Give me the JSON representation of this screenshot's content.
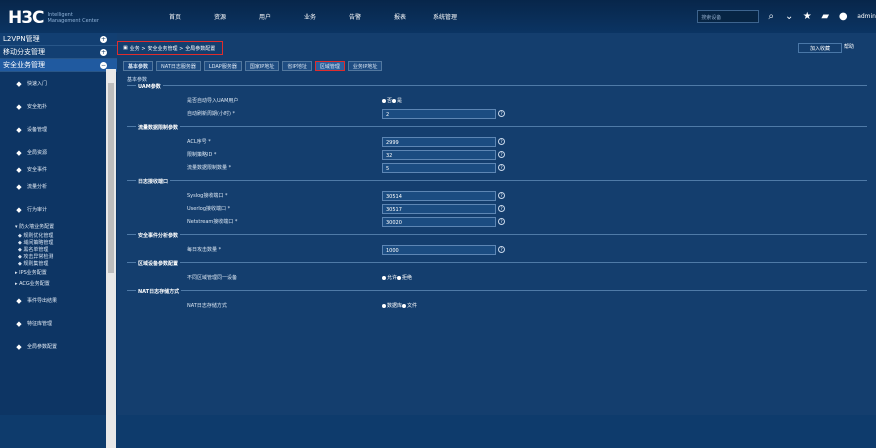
{
  "brand": {
    "main": "H3C",
    "sub1": "Intelligent",
    "sub2": "Management Center"
  },
  "nav": [
    "首页",
    "资源",
    "用户",
    "业务",
    "告警",
    "报表",
    "系统管理"
  ],
  "top_search_placeholder": "搜索设备",
  "admin": "admin",
  "accordion": [
    {
      "label": "L2VPN管理",
      "expanded": false
    },
    {
      "label": "移动分支管理",
      "expanded": false
    },
    {
      "label": "安全业务管理",
      "expanded": true
    }
  ],
  "sidebar": [
    {
      "label": "快速入门",
      "icon": "home-icon"
    },
    {
      "label": "安全拓扑",
      "icon": "topology-icon"
    },
    {
      "label": "设备管理",
      "icon": "device-icon"
    },
    {
      "label": "全局资源",
      "icon": "resource-icon"
    },
    {
      "label": "安全事件",
      "icon": "event-icon",
      "small": true
    },
    {
      "label": "流量分析",
      "icon": "traffic-icon"
    },
    {
      "label": "行为审计",
      "icon": "audit-icon"
    }
  ],
  "firewall": {
    "label": "防火墙业务配置",
    "children": [
      "规则优化管理",
      "域间策略管理",
      "黑名单管理",
      "攻击异常检测",
      "规则集管理"
    ]
  },
  "sidebar2": [
    "IPS业务配置",
    "ACG业务配置"
  ],
  "sidebar3": [
    {
      "label": "事件导出结果",
      "icon": "export-icon"
    },
    {
      "label": "特征库管理",
      "icon": "library-icon"
    },
    {
      "label": "全局参数配置",
      "icon": "settings-icon"
    }
  ],
  "breadcrumb": [
    "业务",
    "安全业务管理",
    "全局参数配置"
  ],
  "favorite": "加入收藏",
  "help": "帮助",
  "tabs": [
    "基本参数",
    "NAT日志服务器",
    "LDAP服务器",
    "国家IP地址",
    "省IP地址",
    "区域管理",
    "业务IP地址"
  ],
  "subtitle": "基本参数",
  "sections": [
    {
      "title": "UAM参数",
      "rows": [
        {
          "label": "是否自动导入UAM用户",
          "type": "radio",
          "options": [
            "否",
            "是"
          ]
        },
        {
          "label": "自动刷新周期(小时) *",
          "type": "input",
          "value": "2"
        }
      ]
    },
    {
      "title": "流量数据限制参数",
      "rows": [
        {
          "label": "ACL序号 *",
          "type": "input",
          "value": "2999"
        },
        {
          "label": "限制策略ID *",
          "type": "input",
          "value": "32"
        },
        {
          "label": "流量数据限制数量 *",
          "type": "input",
          "value": "5"
        }
      ]
    },
    {
      "title": "日志接收端口",
      "rows": [
        {
          "label": "Syslog接收端口 *",
          "type": "input",
          "value": "30514"
        },
        {
          "label": "Userlog接收端口 *",
          "type": "input",
          "value": "30517"
        },
        {
          "label": "Netstream接收端口 *",
          "type": "input",
          "value": "30020"
        }
      ]
    },
    {
      "title": "安全事件分析参数",
      "rows": [
        {
          "label": "每日攻击数量 *",
          "type": "input",
          "value": "1000"
        }
      ]
    },
    {
      "title": "区域设备参数配置",
      "rows": [
        {
          "label": "不同区域管理同一设备",
          "type": "radio",
          "options": [
            "允许",
            "拒绝"
          ]
        }
      ]
    },
    {
      "title": "NAT日志存储方式",
      "rows": [
        {
          "label": "NAT日志存储方式",
          "type": "radio",
          "options": [
            "数据库",
            "文件"
          ]
        }
      ]
    }
  ]
}
